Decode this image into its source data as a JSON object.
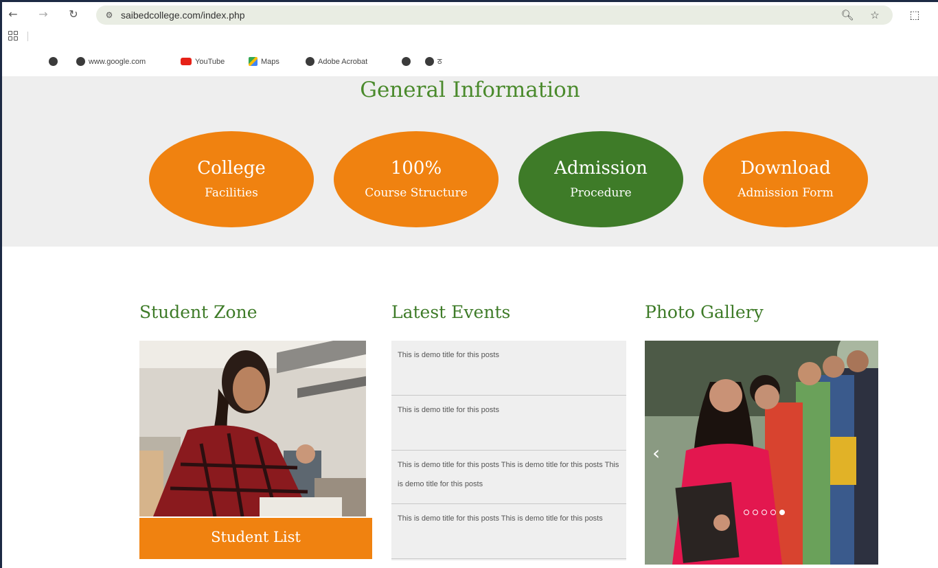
{
  "browser": {
    "url": "saibedcollege.com/index.php",
    "bookmarks": [
      "www.google.com",
      "YouTube",
      "Maps",
      "Adobe Acrobat",
      "ठ"
    ]
  },
  "info": {
    "title": "General Information",
    "buttons": [
      {
        "line1": "College",
        "line2": "Facilities",
        "color": "#f08210"
      },
      {
        "line1": "100%",
        "line2": "Course Structure",
        "color": "#f08210"
      },
      {
        "line1": "Admission",
        "line2": "Procedure",
        "color": "#3e7b28"
      },
      {
        "line1": "Download",
        "line2": "Admission Form",
        "color": "#f08210"
      }
    ]
  },
  "student_zone": {
    "title": "Student Zone",
    "button": "Student List"
  },
  "events": {
    "title": "Latest Events",
    "items": [
      "This is demo title for this posts",
      "This is demo title for this posts",
      "This is demo title for this posts This is demo title for this posts This is demo title for this posts",
      "This is demo title for this posts This is demo title for this posts"
    ]
  },
  "gallery": {
    "title": "Photo Gallery"
  }
}
